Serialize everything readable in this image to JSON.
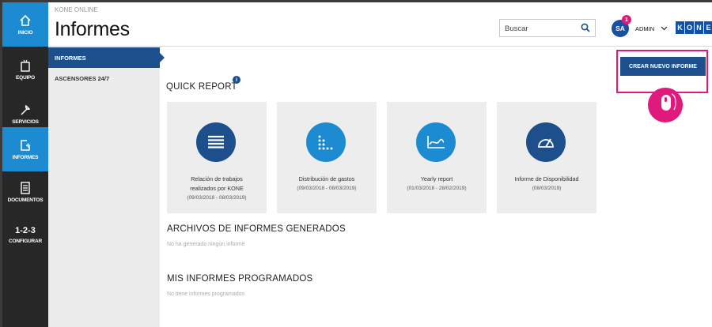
{
  "app": {
    "name": "KONE ONLINE",
    "title": "Informes"
  },
  "rail": [
    {
      "label": "INICIO",
      "icon": "home-icon",
      "active": true
    },
    {
      "label": "EQUIPO",
      "icon": "elevator-icon",
      "active": false
    },
    {
      "label": "SERVICIOS",
      "icon": "wrench-icon",
      "active": false
    },
    {
      "label": "INFORMES",
      "icon": "add-report-icon",
      "active": true
    },
    {
      "label": "DOCUMENTOS",
      "icon": "document-icon",
      "active": false
    },
    {
      "label": "CONFIGURAR",
      "glyph": "1-2-3",
      "active": false
    }
  ],
  "header": {
    "search_placeholder": "Buscar",
    "avatar_initials": "SA",
    "notification_count": "1",
    "user_name": "ADMIN",
    "logo_letters": [
      "K",
      "O",
      "N",
      "E"
    ]
  },
  "subnav": [
    {
      "label": "INFORMES",
      "active": true
    },
    {
      "label": "ASCENSORES 24/7",
      "active": false
    }
  ],
  "quick_report": {
    "title": "QUICK REPORT",
    "info_glyph": "i",
    "cards": [
      {
        "title_line1": "Relación de trabajos",
        "title_line2": "realizados por KONE",
        "date": "(09/03/2018 - 08/03/2019)",
        "icon": "list-icon"
      },
      {
        "title_line1": "Distribución de gastos",
        "title_line2": "",
        "date": "(09/03/2018 - 08/03/2019)",
        "icon": "dot-chart-icon"
      },
      {
        "title_line1": "Yearly report",
        "title_line2": "",
        "date": "(01/03/2018 - 28/02/2019)",
        "icon": "line-chart-icon"
      },
      {
        "title_line1": "Informe de Disponibilidad",
        "title_line2": "",
        "date": "(08/03/2019)",
        "icon": "gauge-icon"
      }
    ]
  },
  "generated": {
    "title": "ARCHIVOS DE INFORMES GENERADOS",
    "empty": "No ha generado ningún informe"
  },
  "scheduled": {
    "title": "MIS INFORMES PROGRAMADOS",
    "empty": "No tiene informes programados"
  },
  "create_button": "CREAR NUEVO INFORME",
  "colors": {
    "accent": "#1d8bd2",
    "navy": "#1c4f8c",
    "highlight": "#e0197d",
    "rail": "#272727"
  }
}
